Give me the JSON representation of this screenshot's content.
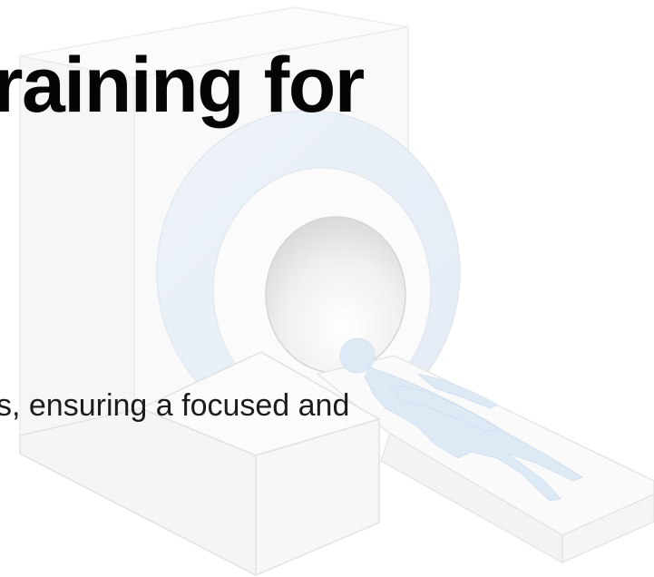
{
  "hero": {
    "headline": "raining for",
    "body": "s, ensuring a focused and"
  },
  "illustration": {
    "icon": "mri-scanner-illustration",
    "colors": {
      "machine": "#f8f8f8",
      "outline": "#e6e6e6",
      "ring": "#eaf0f7",
      "figure": "#dde9f5"
    }
  }
}
